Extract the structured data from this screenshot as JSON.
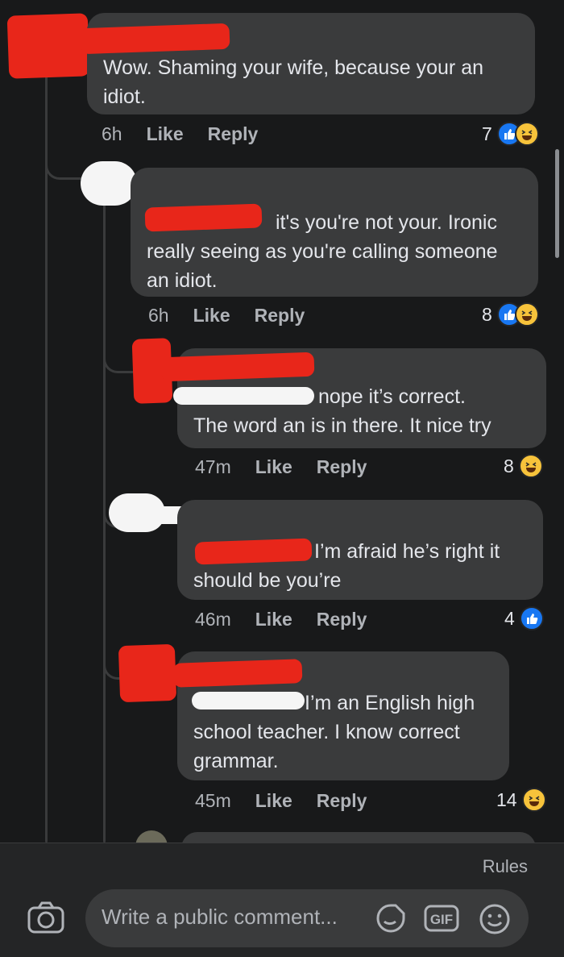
{
  "comments": [
    {
      "text": "Wow. Shaming your wife, because your an idiot.",
      "time": "6h",
      "like_label": "Like",
      "reply_label": "Reply",
      "reaction_count": "7",
      "reactions": [
        "like-icon",
        "haha-icon"
      ]
    },
    {
      "text": "it's you're not your. Ironic really seeing  as you're calling someone an idiot.",
      "time": "6h",
      "like_label": "Like",
      "reply_label": "Reply",
      "reaction_count": "8",
      "reactions": [
        "like-icon",
        "haha-icon"
      ]
    },
    {
      "text_line1": "nope it’s correct.",
      "text_line2": "The word an is in there.  It nice try",
      "time": "47m",
      "like_label": "Like",
      "reply_label": "Reply",
      "reaction_count": "8",
      "reactions": [
        "haha-icon"
      ]
    },
    {
      "text_line1": "I’m afraid he’s right it",
      "text_line2": "should be you’re",
      "time": "46m",
      "like_label": "Like",
      "reply_label": "Reply",
      "reaction_count": "4",
      "reactions": [
        "like-icon"
      ]
    },
    {
      "text_line1": "I’m an English high",
      "text_line2": "school teacher. I know correct",
      "text_line3": "grammar.",
      "time": "45m",
      "like_label": "Like",
      "reply_label": "Reply",
      "reaction_count": "14",
      "reactions": [
        "haha-icon"
      ]
    }
  ],
  "footer": {
    "rules_label": "Rules",
    "composer_placeholder": "Write a public comment...",
    "gif_label": "GIF"
  },
  "colors": {
    "background": "#18191a",
    "bubble": "#3a3b3c",
    "like_blue": "#1877f2",
    "haha_yellow": "#f7c33b",
    "redaction_red": "#e8261a"
  }
}
